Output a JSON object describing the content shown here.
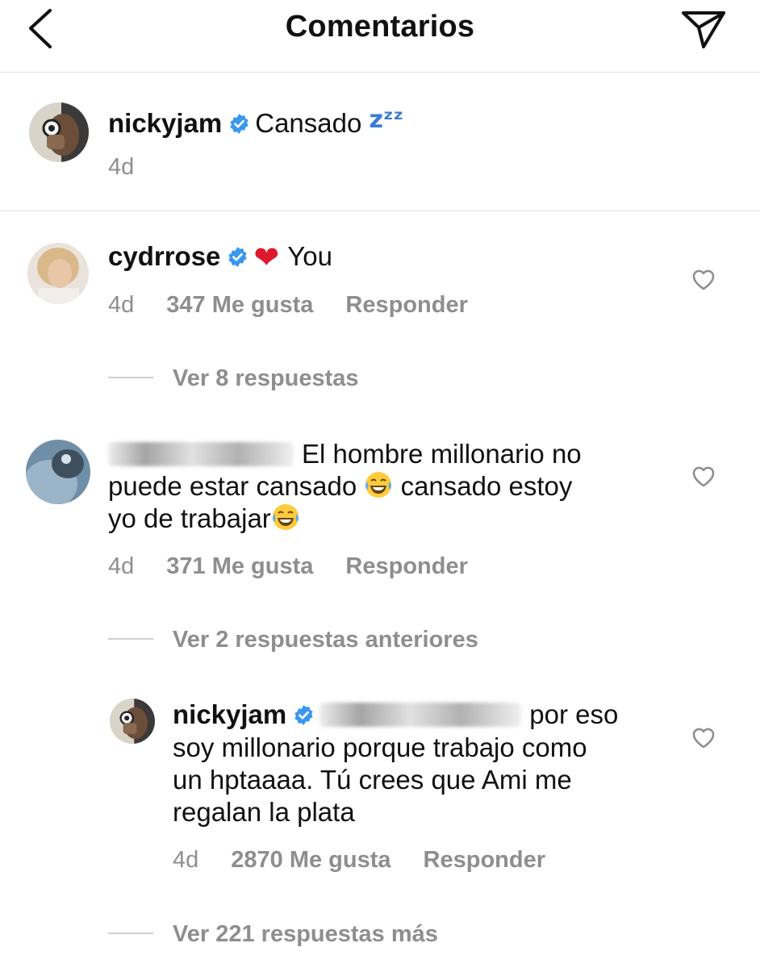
{
  "header": {
    "title": "Comentarios",
    "back_icon": "chevron-left-icon",
    "send_icon": "paper-plane-icon"
  },
  "caption": {
    "username": "nickyjam",
    "text": "Cansado",
    "emoji": "zᶻᶻ",
    "time": "4d"
  },
  "comments": [
    {
      "username": "cydrrose",
      "emoji": "❤",
      "text": "You",
      "time": "4d",
      "likes": "347 Me gusta",
      "reply_label": "Responder",
      "view_replies": "Ver 8 respuestas"
    },
    {
      "username": "",
      "lines": [
        "El hombre millonario no",
        "puede estar cansado",
        "cansado estoy",
        "yo de trabajar"
      ],
      "time": "4d",
      "likes": "371 Me gusta",
      "reply_label": "Responder",
      "view_replies": "Ver 2 respuestas anteriores"
    }
  ],
  "reply": {
    "username": "nickyjam",
    "lines": [
      "por eso",
      "soy millonario porque trabajo como",
      "un hptaaaa.  Tú crees que Ami me",
      "regalan la plata"
    ],
    "time": "4d",
    "likes": "2870 Me gusta",
    "reply_label": "Responder",
    "view_more": "Ver 221 respuestas más"
  },
  "colors": {
    "verified": "#3897f0",
    "meta_gray": "#8e8e8e",
    "divider": "#e2e2e2"
  }
}
